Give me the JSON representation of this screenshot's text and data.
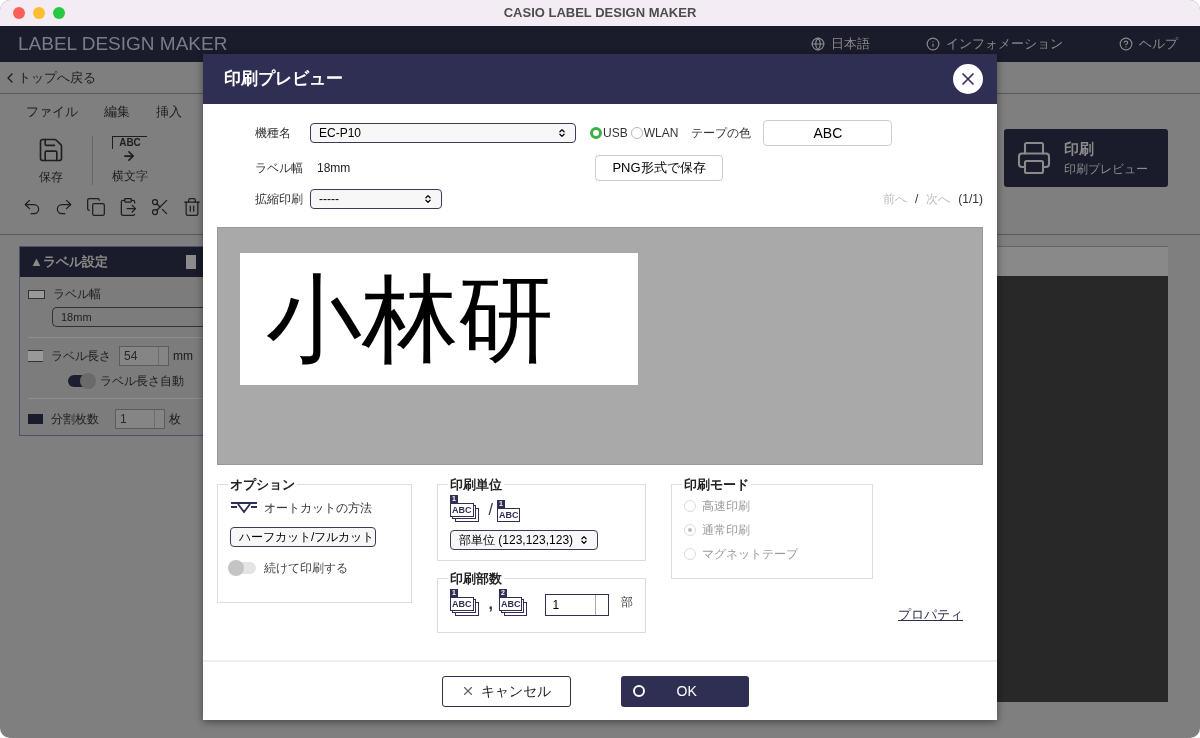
{
  "window": {
    "title": "CASIO LABEL DESIGN MAKER"
  },
  "app_header": {
    "title": "LABEL DESIGN MAKER",
    "links": [
      {
        "kind": "language",
        "label": "日本語"
      },
      {
        "kind": "info",
        "label": "インフォメーション"
      },
      {
        "kind": "help",
        "label": "ヘルプ"
      }
    ]
  },
  "back_link": "トップへ戻る",
  "menu": [
    "ファイル",
    "編集",
    "挿入"
  ],
  "tools": [
    {
      "kind": "save",
      "label": "保存"
    },
    {
      "kind": "horizontal-text",
      "label": "横文字",
      "sample": "ABC"
    }
  ],
  "edit_tools": [
    {
      "kind": "undo"
    },
    {
      "kind": "redo"
    },
    {
      "kind": "copy"
    },
    {
      "kind": "paste"
    },
    {
      "kind": "cut"
    },
    {
      "kind": "delete"
    }
  ],
  "print_card": {
    "title": "印刷",
    "subtitle": "印刷プレビュー"
  },
  "label_settings": {
    "title": "▲ラベル設定",
    "width": {
      "label": "ラベル幅",
      "value": "18mm"
    },
    "length": {
      "label": "ラベル長さ",
      "value": "54",
      "unit": "mm"
    },
    "auto_length": {
      "label": "ラベル長さ自動",
      "on": true
    },
    "split": {
      "label": "分割枚数",
      "value": "1",
      "unit": "枚"
    }
  },
  "dialog": {
    "title": "印刷プレビュー",
    "model": {
      "label": "機種名",
      "value": "EC-P10"
    },
    "connection": [
      {
        "label": "USB",
        "selected": true
      },
      {
        "label": "WLAN",
        "selected": false
      }
    ],
    "tape_color": {
      "label": "テープの色",
      "value": "ABC"
    },
    "label_width": {
      "label": "ラベル幅",
      "value": "18mm"
    },
    "save_png": "PNG形式で保存",
    "scale_print": {
      "label": "拡縮印刷",
      "value": "-----"
    },
    "pager": {
      "prev": {
        "label": "前へ",
        "disabled": true
      },
      "separator": "/",
      "next": {
        "label": "次へ",
        "disabled": true
      },
      "count": "(1/1)"
    },
    "preview": {
      "text": "小林研"
    },
    "options": {
      "title": "オプション",
      "autocut_label": "オートカットの方法",
      "autocut_value": "ハーフカット/フルカット",
      "continuous": {
        "label": "続けて印刷する",
        "on": false
      }
    },
    "print_unit": {
      "title": "印刷単位",
      "icons": [
        {
          "badge": "1",
          "text": "ABC",
          "stacked": true
        },
        {
          "badge": "1",
          "text": "ABC",
          "stacked": false
        }
      ],
      "separator": "/",
      "value": "部単位 (123,123,123)"
    },
    "copies": {
      "title": "印刷部数",
      "icons": [
        {
          "badge": "1",
          "text": "ABC",
          "stacked": true
        },
        {
          "badge": "2",
          "text": "ABC",
          "stacked": true
        }
      ],
      "separator": ",",
      "value": "1",
      "unit": "部"
    },
    "print_mode": {
      "title": "印刷モード",
      "disabled": true,
      "options": [
        {
          "label": "高速印刷",
          "selected": false
        },
        {
          "label": "通常印刷",
          "selected": true
        },
        {
          "label": "マグネットテープ",
          "selected": false
        }
      ]
    },
    "properties_link": "プロパティ",
    "buttons": [
      {
        "kind": "cancel",
        "label": "キャンセル"
      },
      {
        "kind": "ok",
        "label": "OK"
      }
    ]
  }
}
